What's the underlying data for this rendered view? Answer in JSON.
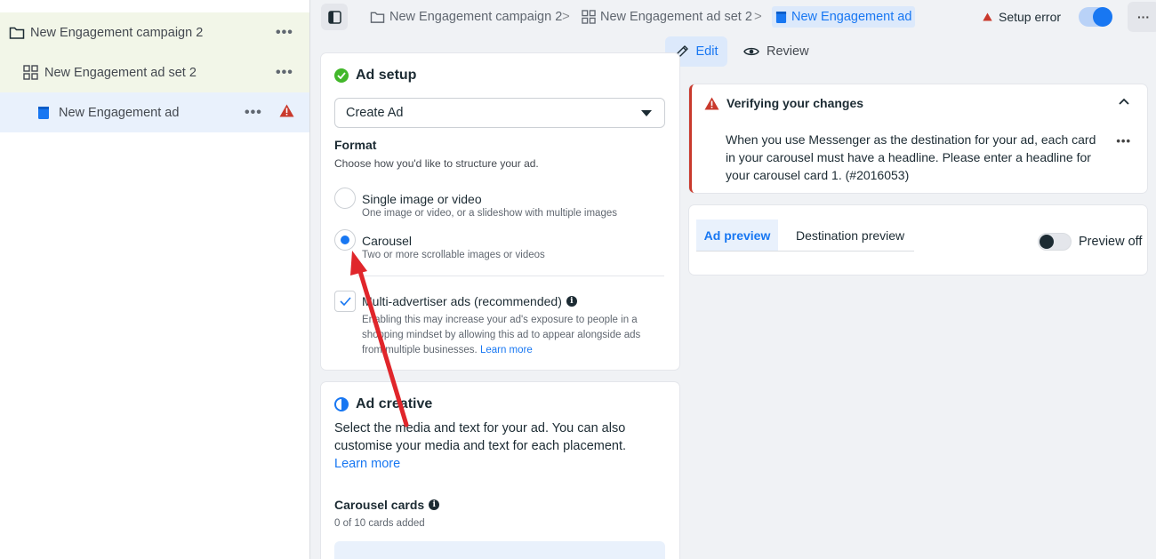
{
  "sidebar": {
    "items": [
      {
        "label": "New Engagement campaign 2",
        "icon": "folder-icon"
      },
      {
        "label": "New Engagement ad set 2",
        "icon": "grid-icon"
      },
      {
        "label": "New Engagement ad",
        "icon": "ad-icon"
      }
    ]
  },
  "breadcrumb": {
    "items": [
      "New Engagement campaign 2",
      "New Engagement ad set 2",
      "New Engagement ad"
    ]
  },
  "status": {
    "setup_error": "Setup error"
  },
  "mode": {
    "edit": "Edit",
    "review": "Review"
  },
  "ad_setup": {
    "title": "Ad setup",
    "create_select": "Create Ad",
    "format_title": "Format",
    "format_sub": "Choose how you'd like to structure your ad.",
    "options": [
      {
        "title": "Single image or video",
        "sub": "One image or video, or a slideshow with multiple images",
        "selected": false
      },
      {
        "title": "Carousel",
        "sub": "Two or more scrollable images or videos",
        "selected": true
      }
    ],
    "multi_advertiser": {
      "title": "Multi-advertiser ads (recommended)",
      "desc": "Enabling this may increase your ad's exposure to people in a shopping mindset by allowing this ad to appear alongside ads from multiple businesses.",
      "link": "Learn more",
      "checked": true
    }
  },
  "ad_creative": {
    "title": "Ad creative",
    "desc": "Select the media and text for your ad. You can also customise your media and text for each placement.",
    "link": "Learn more",
    "carousel_title": "Carousel cards",
    "carousel_sub": "0 of 10 cards added"
  },
  "verify": {
    "title": "Verifying your changes",
    "body": "When you use Messenger as the destination for your ad, each card in your carousel must have a headline. Please enter a headline for your carousel card 1. (#2016053)"
  },
  "preview": {
    "tabs": [
      "Ad preview",
      "Destination preview"
    ],
    "toggle_label": "Preview off"
  },
  "colors": {
    "accent": "#1877f2",
    "error": "#c9392c",
    "success": "#42b72a",
    "annotation": "#e0262b"
  }
}
